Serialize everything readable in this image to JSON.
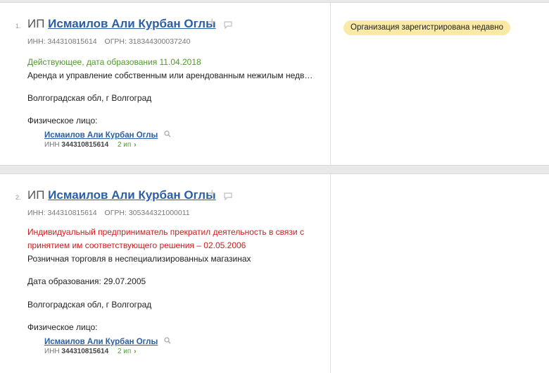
{
  "entries": [
    {
      "index": "1.",
      "prefix": "ИП",
      "name": "Исмаилов Али Курбан Оглы",
      "inn": "ИНН: 344310815614",
      "ogrn": "ОГРН: 318344300037240",
      "status": "Действующее, дата образования 11.04.2018",
      "activity": "Аренда и управление собственным или арендованным нежилым недв…",
      "region": "Волгоградская обл, г Волгоград",
      "person_label": "Физическое лицо:",
      "person_name": "Исмаилов Али Курбан Оглы",
      "person_inn_label": "ИНН",
      "person_inn": "344310815614",
      "person_count": "2 ип",
      "badge": "Организация зарегистрирована недавно"
    },
    {
      "index": "2.",
      "prefix": "ИП",
      "name": "Исмаилов Али Курбан Оглы",
      "inn": "ИНН: 344310815614",
      "ogrn": "ОГРН: 305344321000011",
      "status_line1": "Индивидуальный предприниматель прекратил деятельность в связи с",
      "status_line2": "принятием им соответствующего решения – 02.05.2006",
      "activity": "Розничная торговля в неспециализированных магазинах",
      "formation": "Дата образования: 29.07.2005",
      "region": "Волгоградская обл, г Волгоград",
      "person_label": "Физическое лицо:",
      "person_name": "Исмаилов Али Курбан Оглы",
      "person_inn_label": "ИНН",
      "person_inn": "344310815614",
      "person_count": "2 ип"
    }
  ],
  "icons": {
    "add": "plus-icon",
    "comment": "comment-icon",
    "search": "magnifier-icon",
    "more": "chevron-right-icon"
  },
  "colors": {
    "link": "#2a5fa8",
    "active_status": "#4f9a2a",
    "closed_status": "#cc1c1c",
    "badge_bg": "#fbeaa5"
  }
}
